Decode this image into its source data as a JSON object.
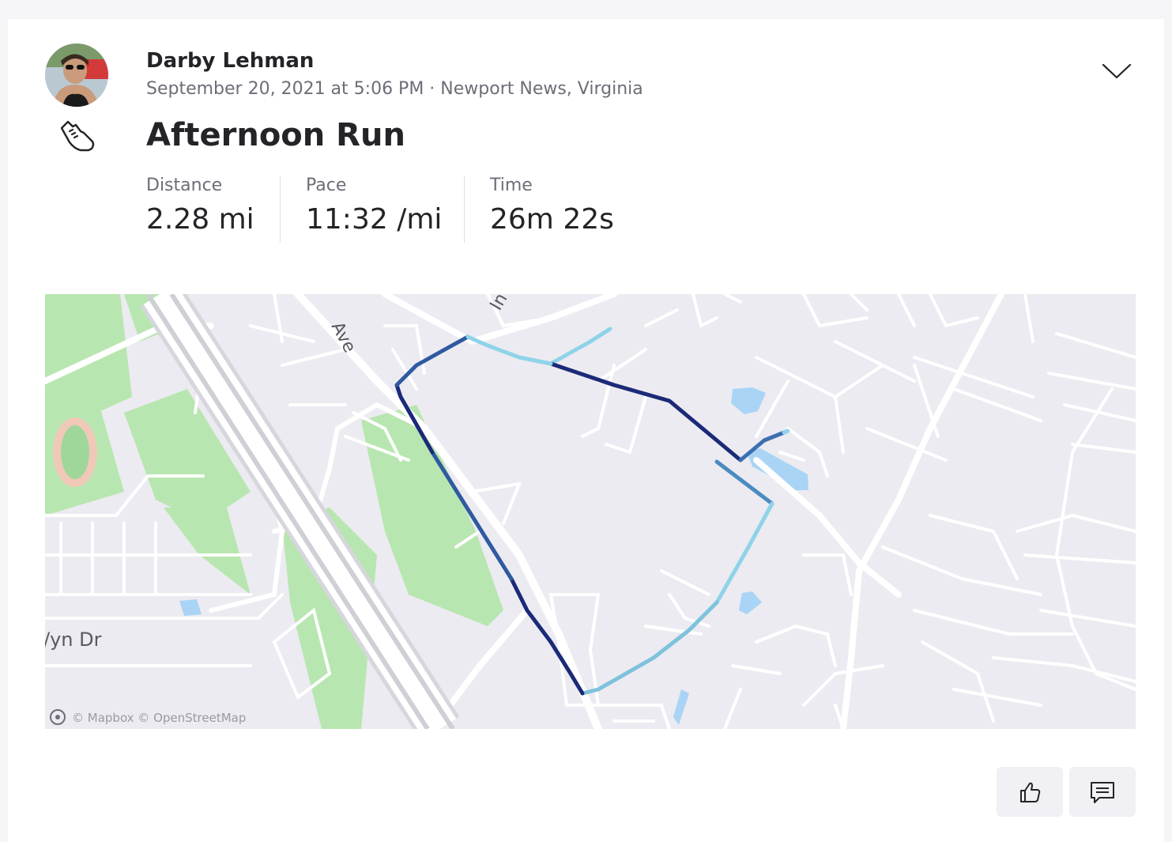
{
  "activity": {
    "athlete_name": "Darby Lehman",
    "meta": "September 20, 2021 at 5:06 PM · Newport News, Virginia",
    "title": "Afternoon Run",
    "sport_icon": "running-shoe-icon"
  },
  "stats": [
    {
      "label": "Distance",
      "value": "2.28 mi"
    },
    {
      "label": "Pace",
      "value": "11:32 /mi"
    },
    {
      "label": "Time",
      "value": "26m 22s"
    }
  ],
  "map": {
    "street_labels": [
      "Ave",
      "In",
      "/yn Dr"
    ],
    "attribution": "© Mapbox © OpenStreetMap",
    "route_colors": {
      "dark": "#1b2a78",
      "mid": "#3b6fb0",
      "light": "#8fd3e8"
    },
    "water_color": "#a9d4f5",
    "park_color": "#b8e6b0"
  },
  "actions": {
    "kudos_icon": "thumbs-up-icon",
    "comment_icon": "comment-icon",
    "menu_icon": "chevron-down-icon"
  }
}
